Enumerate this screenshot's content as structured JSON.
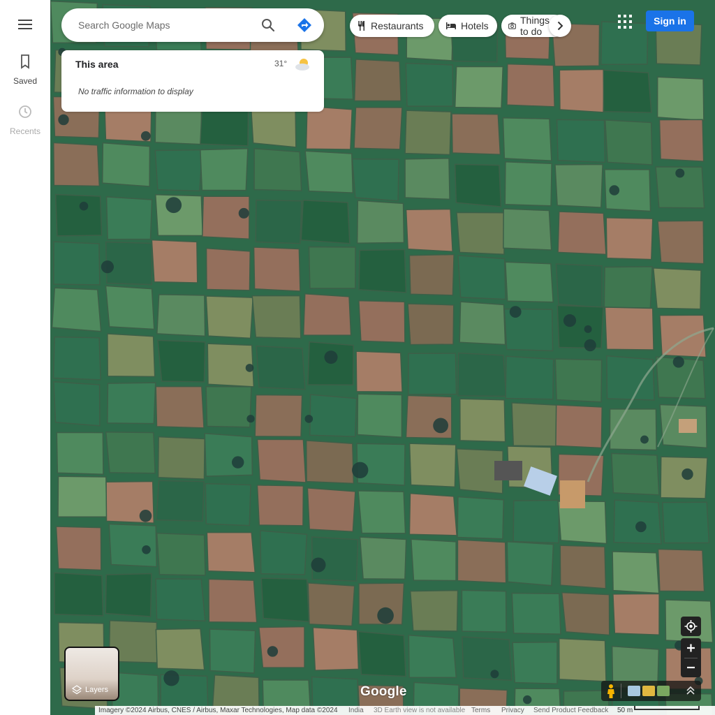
{
  "rail": {
    "saved_label": "Saved",
    "recents_label": "Recents"
  },
  "search": {
    "placeholder": "Search Google Maps"
  },
  "card": {
    "title": "This area",
    "temperature": "31°",
    "message": "No traffic information to display",
    "weather_icon": "partly-cloudy-icon"
  },
  "chips": {
    "restaurants": "Restaurants",
    "hotels": "Hotels",
    "things": "Things to do"
  },
  "header": {
    "sign_in": "Sign in"
  },
  "layers": {
    "label": "Layers"
  },
  "brand": {
    "logo_text": "Google"
  },
  "footer": {
    "imagery": "Imagery ©2024 Airbus, CNES / Airbus, Maxar Technologies, Map data ©2024",
    "region": "India",
    "earth_3d": "3D Earth view is not available",
    "terms": "Terms",
    "privacy": "Privacy",
    "feedback": "Send Product Feedback",
    "scale": "50 m"
  },
  "colors": {
    "accent": "#1a73e8",
    "map_base": "#2f6b4a"
  }
}
